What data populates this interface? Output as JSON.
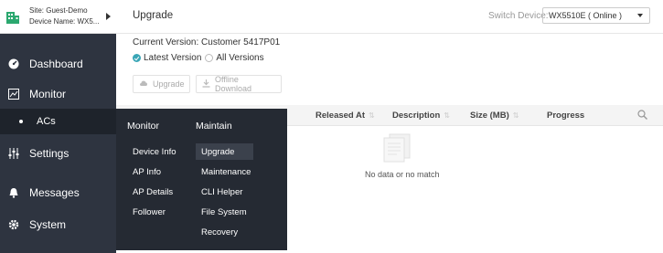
{
  "sidebar": {
    "site": {
      "line1": "Site: Guest-Demo",
      "line2": "Device Name: WX5...",
      "icon": "building-icon"
    },
    "items": [
      {
        "label": "Dashboard",
        "icon": "dashboard-icon"
      },
      {
        "label": "Monitor",
        "icon": "monitor-icon"
      },
      {
        "label": "Settings",
        "icon": "sliders-icon"
      },
      {
        "label": "Messages",
        "icon": "bell-icon"
      },
      {
        "label": "System",
        "icon": "gear-icon"
      }
    ],
    "sub_item": {
      "label": "ACs"
    }
  },
  "flyout": {
    "monitor_header": "Monitor",
    "maintain_header": "Maintain",
    "monitor_items": [
      "Device Info",
      "AP Info",
      "AP Details",
      "Follower"
    ],
    "maintain_items": [
      "Upgrade",
      "Maintenance",
      "CLI Helper",
      "File System",
      "Recovery"
    ]
  },
  "header": {
    "title": "Upgrade",
    "switch_label": "Switch Device:",
    "switch_value": "WX5510E ( Online )"
  },
  "main": {
    "current_version": "Current Version: Customer 5417P01",
    "radio_latest": "Latest Version",
    "radio_all": "All Versions",
    "upgrade_button": "Upgrade",
    "offline_button": "Offline Download",
    "columns": [
      "Released At",
      "Description",
      "Size (MB)",
      "Progress"
    ],
    "empty_text": "No data or no match"
  },
  "colors": {
    "sidebar_bg": "#2e3440",
    "flyout_bg": "#252a33",
    "accent": "#3aa6b6"
  }
}
